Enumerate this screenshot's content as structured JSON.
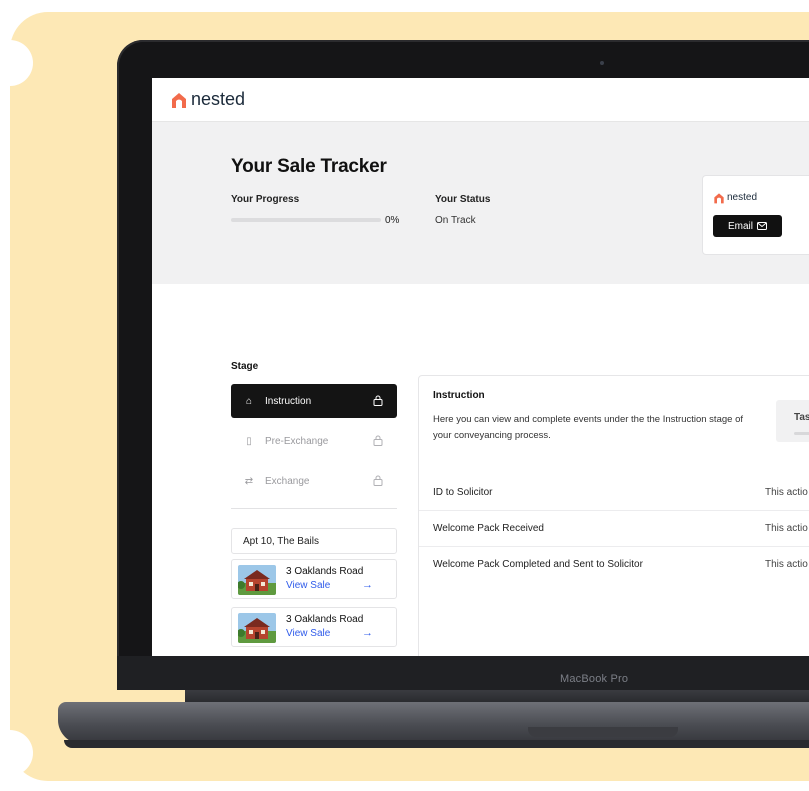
{
  "brand": {
    "name": "nested",
    "accent": "#f26b4b"
  },
  "hero": {
    "title": "Your Sale Tracker",
    "progress_label": "Your Progress",
    "progress_value": 0,
    "progress_text": "0%",
    "status_label": "Your Status",
    "status_value": "On Track"
  },
  "agent_card": {
    "brand": "nested",
    "email_label": "Email",
    "email_icon": "mail-icon"
  },
  "stages": {
    "heading": "Stage",
    "items": [
      {
        "label": "Instruction",
        "icon": "home-icon",
        "active": true
      },
      {
        "label": "Pre-Exchange",
        "icon": "document-icon",
        "active": false
      },
      {
        "label": "Exchange",
        "icon": "exchange-icon",
        "active": false
      }
    ]
  },
  "properties": {
    "current": "Apt 10, The Bails",
    "sales": [
      {
        "address": "3 Oaklands Road",
        "link": "View Sale",
        "arrow": "→"
      },
      {
        "address": "3 Oaklands Road",
        "link": "View Sale",
        "arrow": "→"
      }
    ]
  },
  "detail": {
    "title": "Instruction",
    "description": "Here you can view and complete events under the the Instruction stage of your conveyancing process.",
    "task_label": "Tas",
    "events": [
      {
        "name": "ID to Solicitor",
        "note": "This actio"
      },
      {
        "name": "Welcome Pack Received",
        "note": "This actio"
      },
      {
        "name": "Welcome Pack Completed and Sent to Solicitor",
        "note": "This actio"
      }
    ]
  },
  "device": {
    "label": "MacBook Pro"
  }
}
